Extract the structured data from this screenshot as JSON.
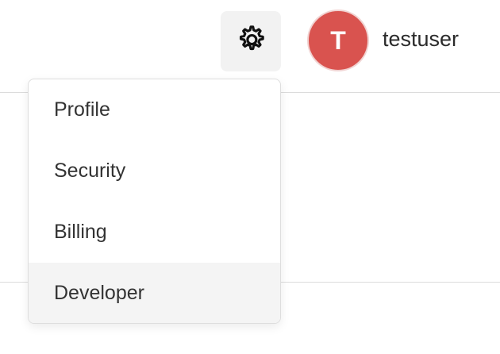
{
  "header": {
    "settings_icon": "gear-icon",
    "avatar_initial": "T",
    "avatar_color": "#d9534f",
    "username": "testuser"
  },
  "dropdown": {
    "items": [
      {
        "label": "Profile",
        "active": false
      },
      {
        "label": "Security",
        "active": false
      },
      {
        "label": "Billing",
        "active": false
      },
      {
        "label": "Developer",
        "active": true
      }
    ],
    "hover_background": "#f4f4f4"
  }
}
